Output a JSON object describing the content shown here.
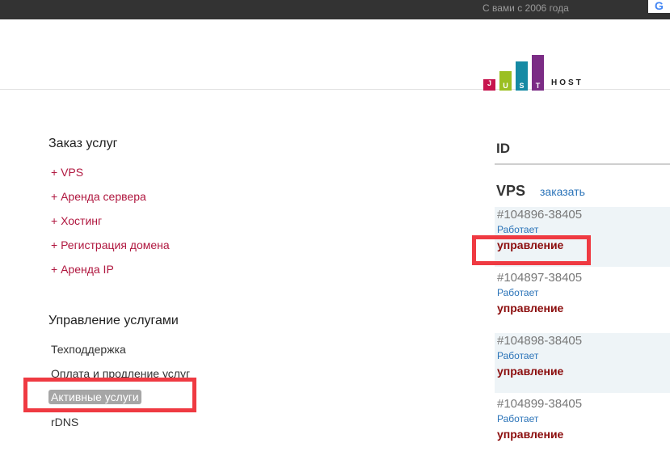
{
  "topbar": {
    "tagline": "С вами с 2006 года",
    "google_icon": "G"
  },
  "logo": {
    "letters": [
      "J",
      "U",
      "S",
      "T"
    ],
    "word": "HOST",
    "colors": [
      "#c7154e",
      "#9bbf22",
      "#168aa4",
      "#7b2c85"
    ]
  },
  "order": {
    "title": "Заказ услуг",
    "links": [
      "+ VPS",
      "+ Аренда сервера",
      "+ Хостинг",
      "+ Регистрация домена",
      "+ Аренда IP"
    ]
  },
  "manage": {
    "title": "Управление услугами",
    "links": [
      "Техподдержка",
      "Оплата и продление услуг",
      "Активные услуги",
      "rDNS"
    ],
    "active_index": 2
  },
  "services": {
    "id_header": "ID",
    "group_title": "VPS",
    "order_label": "заказать",
    "items": [
      {
        "id": "#104896-38405",
        "status": "Работает",
        "action": "управление"
      },
      {
        "id": "#104897-38405",
        "status": "Работает",
        "action": "управление"
      },
      {
        "id": "#104898-38405",
        "status": "Работает",
        "action": "управление"
      },
      {
        "id": "#104899-38405",
        "status": "Работает",
        "action": "управление"
      }
    ]
  }
}
